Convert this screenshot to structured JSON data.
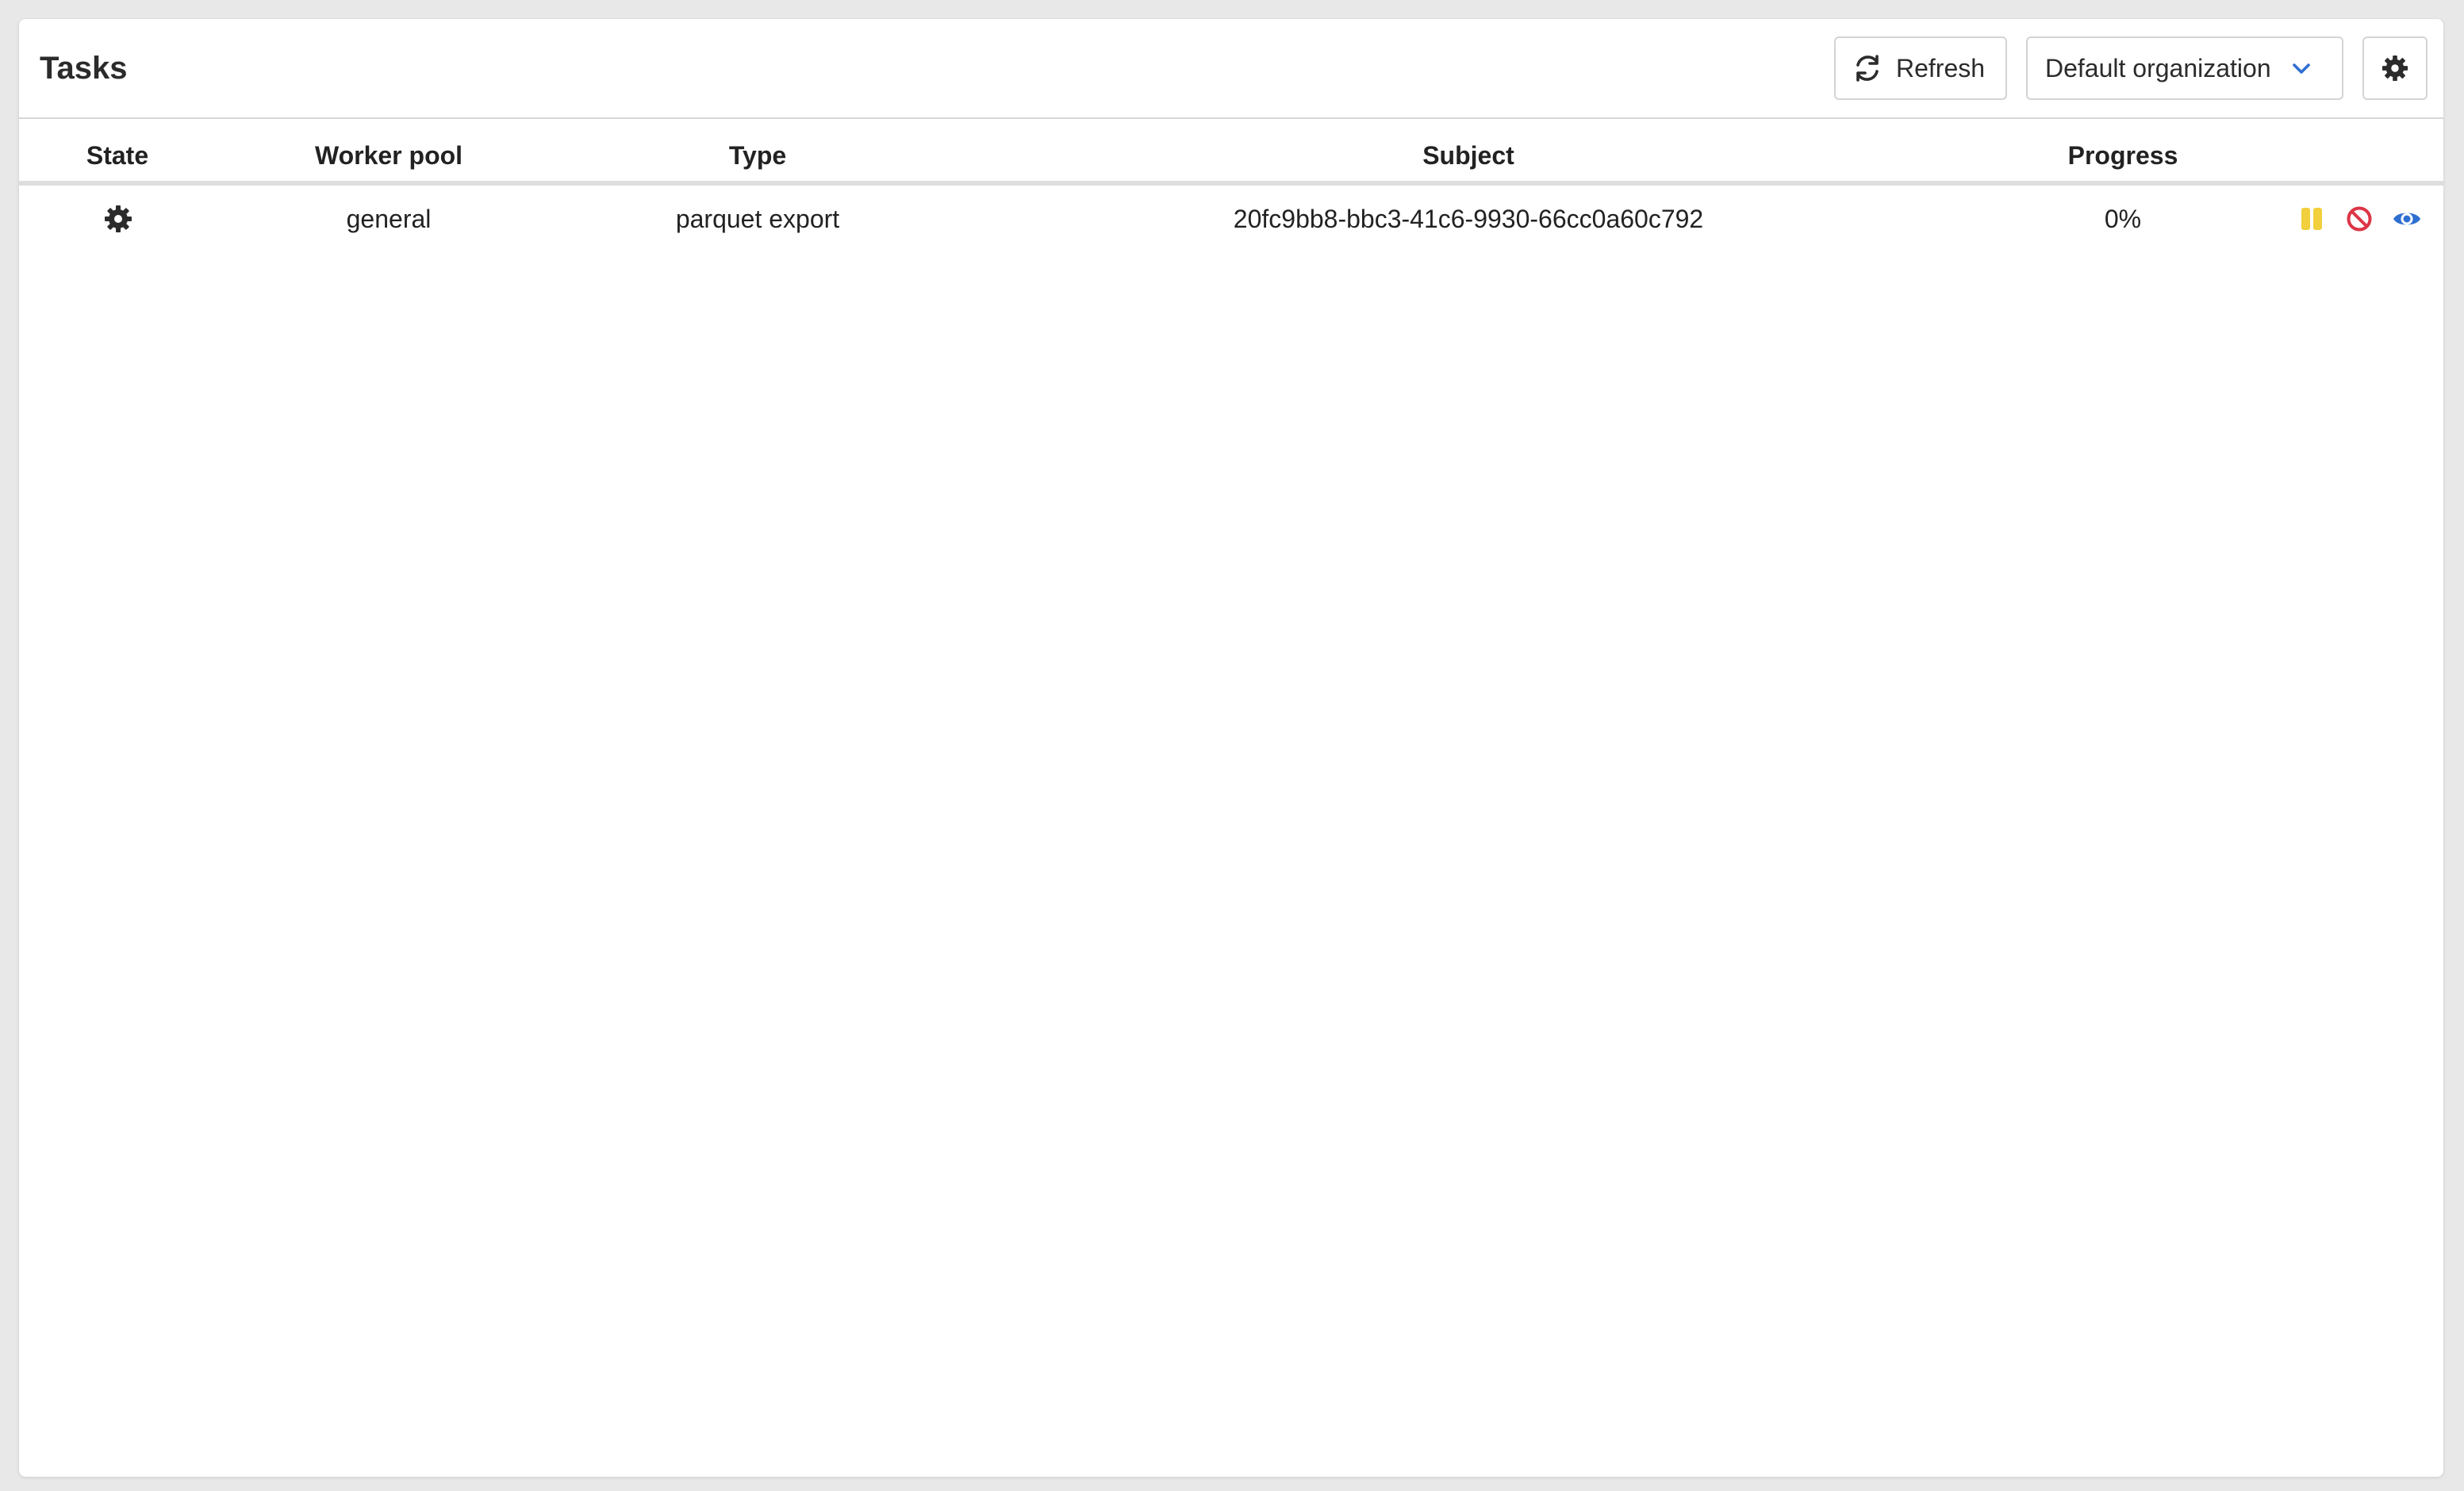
{
  "header": {
    "title": "Tasks",
    "refresh_label": "Refresh",
    "organization_selected": "Default organization"
  },
  "table": {
    "columns": [
      "State",
      "Worker pool",
      "Type",
      "Subject",
      "Progress"
    ],
    "rows": [
      {
        "state_icon": "gear-icon",
        "worker_pool": "general",
        "type": "parquet export",
        "subject": "20fc9bb8-bbc3-41c6-9930-66cc0a60c792",
        "progress": "0%",
        "actions": [
          "pause-icon",
          "cancel-icon",
          "eye-icon"
        ]
      }
    ]
  },
  "colors": {
    "pause": "#f2cf3c",
    "cancel": "#dc3545",
    "view": "#2f6fd1",
    "chevron": "#2f6fd1",
    "icon_dark": "#2b2b2b"
  }
}
